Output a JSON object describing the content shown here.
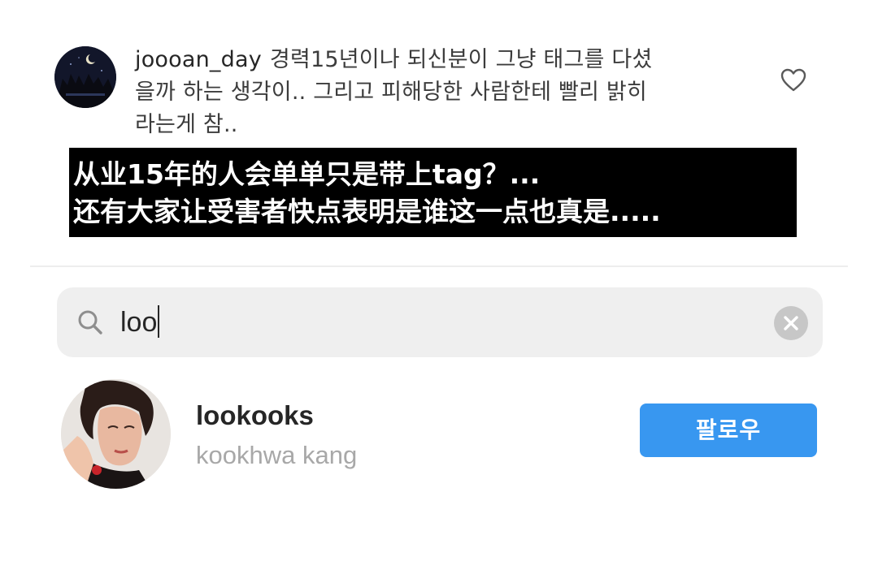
{
  "comment": {
    "username": "joooan_day",
    "lines": [
      "경력15년이나 되신분이 그냥 태그를 다셨",
      "을까 하는 생각이.. 그리고 피해당한 사람한테 빨리 밝히",
      "라는게 참.."
    ],
    "like_icon": "heart-outline-icon"
  },
  "subtitle": {
    "lines": [
      "从业15年的人会单单只是带上tag？...",
      "还有大家让受害者快点表明是谁这一点也真是....."
    ]
  },
  "search": {
    "icon": "search-icon",
    "value": "loo",
    "clear_icon": "clear-icon"
  },
  "result": {
    "username": "lookooks",
    "full_name": "kookhwa kang",
    "follow_label": "팔로우"
  },
  "colors": {
    "follow_button": "#3897f0",
    "search_background": "#efefef",
    "secondary_text": "#a8a8a8",
    "subtitle_background": "#000000"
  }
}
